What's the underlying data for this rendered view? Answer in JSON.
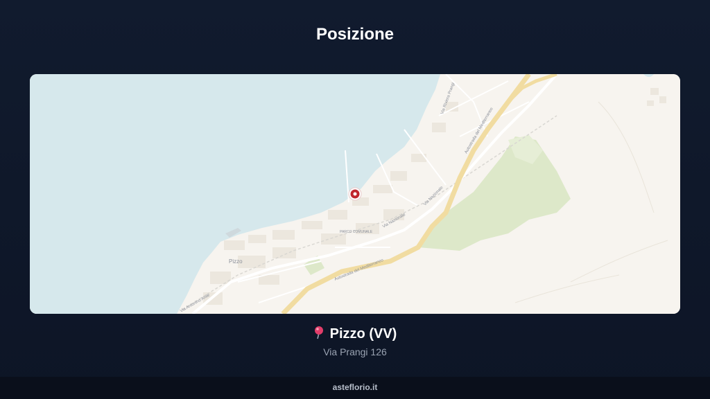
{
  "header": {
    "title": "Posizione"
  },
  "map": {
    "place_label": "Pizzo",
    "park_label": "PARCO COMUNALE",
    "roads": [
      "Via Nazionale",
      "Via Nazionale",
      "Autostrada del Mediterraneo",
      "Autostrada del Mediterraneo",
      "Via Riviera Prangi",
      "Via Antonino Anile"
    ],
    "colors": {
      "sea": "#d6e8ec",
      "land": "#f7f4ef",
      "green": "#dde8c9",
      "motorway": "#f1dca1",
      "marker": "#c0262d"
    }
  },
  "location": {
    "pin_icon": "round-pushpin-icon",
    "city": "Pizzo (VV)",
    "street": "Via Prangi 126"
  },
  "footer": {
    "brand": "asteflorio.it"
  }
}
